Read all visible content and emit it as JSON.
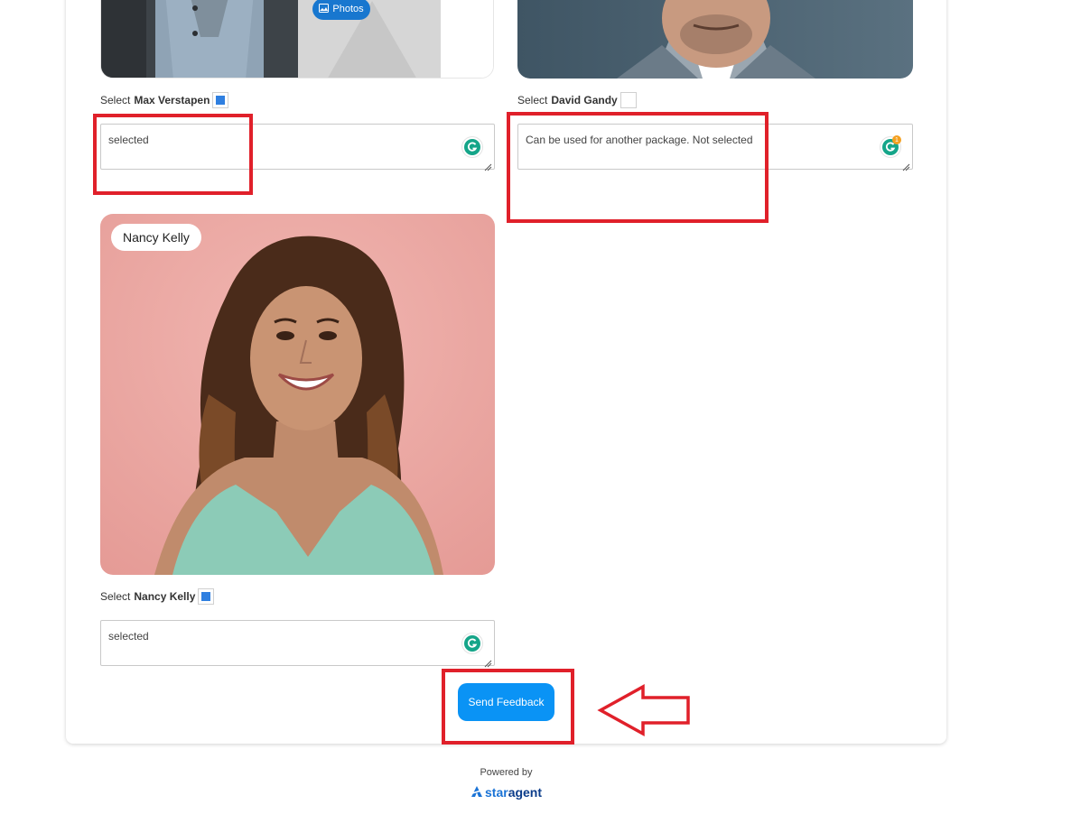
{
  "candidates": [
    {
      "name": "Max Verstapen",
      "select_prefix": "Select",
      "checked": true,
      "comment": "selected"
    },
    {
      "name": "David Gandy",
      "select_prefix": "Select",
      "checked": false,
      "comment": "Can be used for another package. Not selected"
    },
    {
      "name": "Nancy Kelly",
      "chip_label": "Nancy Kelly",
      "select_prefix": "Select",
      "checked": true,
      "comment": "selected"
    }
  ],
  "photos_pill": {
    "label": "Photos"
  },
  "actions": {
    "send_feedback": "Send Feedback"
  },
  "footer": {
    "powered_by": "Powered by",
    "brand_star": "star",
    "brand_agent": "agent"
  },
  "grammarly": {
    "badge_count": "1"
  },
  "colors": {
    "button": "#0a93f5",
    "annotation_red": "#e0202a",
    "checkbox_blue": "#2f7fe0",
    "photos_pill": "#1877cf",
    "grammarly_green": "#15a589"
  }
}
